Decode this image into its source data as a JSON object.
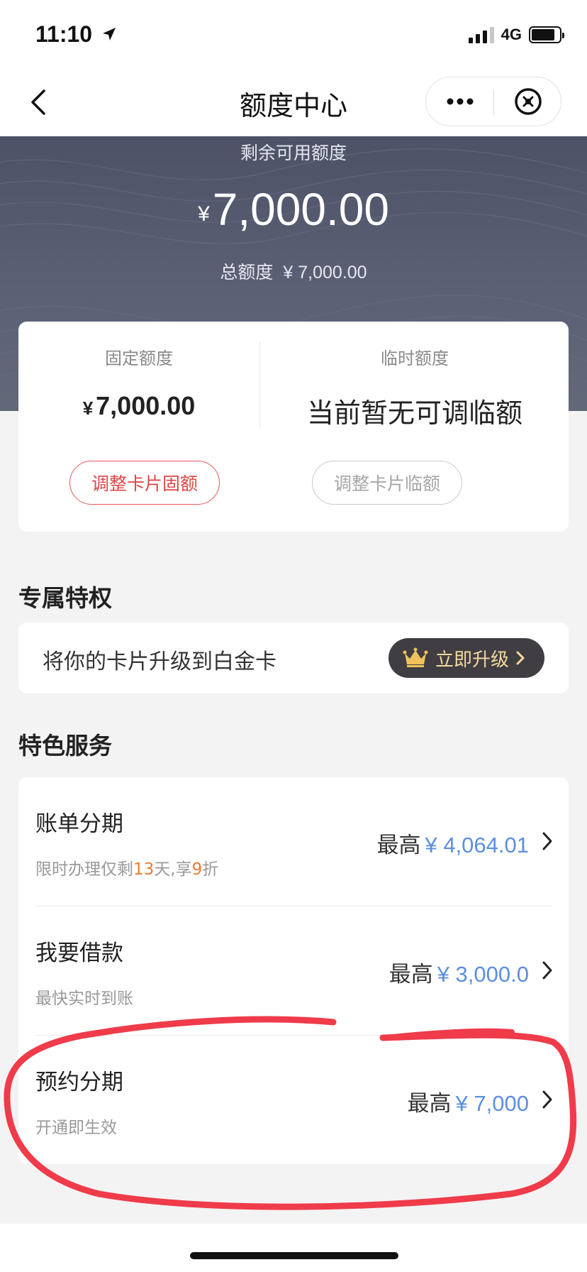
{
  "status_bar": {
    "time": "11:10",
    "location_arrow": "➤",
    "network": "4G",
    "icons": [
      "location-arrow-icon",
      "signal-icon",
      "battery-icon"
    ]
  },
  "nav": {
    "title": "额度中心",
    "icons": [
      "back-chevron-icon",
      "more-dots-icon",
      "close-circle-icon"
    ]
  },
  "hero": {
    "label": "剩余可用额度",
    "currency": "¥",
    "amount": "7,000.00",
    "total_label": "总额度",
    "total_value": "¥ 7,000.00"
  },
  "quota": {
    "fixed_label": "固定额度",
    "fixed_currency": "¥",
    "fixed_value": "7,000.00",
    "temp_label": "临时额度",
    "temp_value": "当前暂无可调临额",
    "adjust_fixed_button": "调整卡片固额",
    "adjust_temp_button": "调整卡片临额"
  },
  "privilege": {
    "section_title": "专属特权",
    "text": "将你的卡片升级到白金卡",
    "upgrade_button": "立即升级",
    "icons": [
      "crown-icon",
      "chevron-right-icon"
    ]
  },
  "services": {
    "section_title": "特色服务",
    "items": [
      {
        "title": "账单分期",
        "sub_parts": [
          "限时办理仅剩",
          "13",
          "天,享",
          "9",
          "折"
        ],
        "prefix": "最高",
        "amount": "¥ 4,064.01"
      },
      {
        "title": "我要借款",
        "subtitle": "最快实时到账",
        "prefix": "最高",
        "amount": "¥ 3,000.0"
      },
      {
        "title": "预约分期",
        "subtitle": "开通即生效",
        "prefix": "最高",
        "amount": "¥ 7,000"
      }
    ]
  },
  "colors": {
    "hero_bg": "#555a6e",
    "accent_red": "#e04747",
    "amount_blue": "#5b8fe0",
    "highlight_orange": "#f07a2c",
    "annotation_red": "#ef3b4a",
    "upgrade_bg": "#403e42",
    "upgrade_text": "#f3d9a0"
  }
}
